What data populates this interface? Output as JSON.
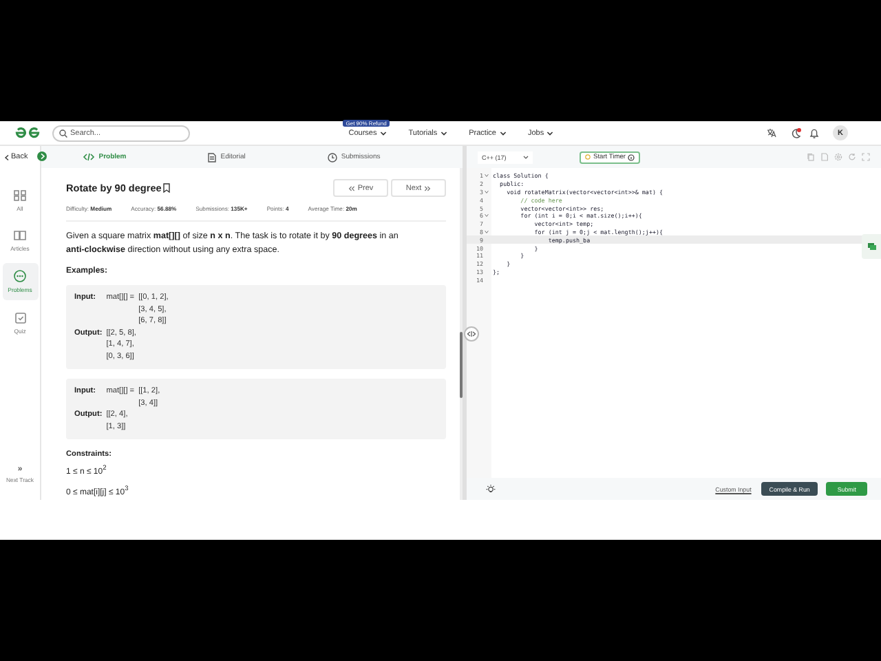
{
  "header": {
    "search": {
      "placeholder": "Search..."
    },
    "nav": [
      {
        "label": "Courses",
        "badge": "Get 90% Refund"
      },
      {
        "label": "Tutorials"
      },
      {
        "label": "Practice"
      },
      {
        "label": "Jobs"
      }
    ],
    "notification_dot": true,
    "avatar": "K"
  },
  "sidebar": {
    "back": "Back",
    "items": [
      {
        "label": "All",
        "selected": false
      },
      {
        "label": "Articles",
        "selected": false
      },
      {
        "label": "Problems",
        "selected": true
      },
      {
        "label": "Quiz",
        "selected": false
      }
    ],
    "next_track": {
      "icon": "»",
      "label": "Next Track"
    }
  },
  "tabs": [
    {
      "label": "Problem",
      "selected": true
    },
    {
      "label": "Editorial",
      "selected": false
    },
    {
      "label": "Submissions",
      "selected": false
    }
  ],
  "problem": {
    "title": "Rotate by 90 degree",
    "prev": "Prev",
    "next": "Next",
    "meta": [
      {
        "label": "Difficulty:",
        "value": "Medium"
      },
      {
        "label": "Accuracy:",
        "value": "56.88%"
      },
      {
        "label": "Submissions:",
        "value": "135K+"
      },
      {
        "label": "Points:",
        "value": "4"
      },
      {
        "label": "Average Time:",
        "value": "20m"
      }
    ],
    "description": "Given a square matrix **mat[][]** of size **n x n**. The task is to rotate it by **90 degrees** in an **anti-clockwise** direction without using any extra space.",
    "examples_heading": "Examples:",
    "examples": [
      {
        "input_label": "Input:",
        "input_prefix": "mat[][] =",
        "input_lines": [
          "[[0, 1, 2],",
          "[3, 4, 5],",
          "[6, 7, 8]]"
        ],
        "output_label": "Output:",
        "output_lines": [
          "[[2, 5, 8],",
          "[1, 4, 7],",
          "[0, 3, 6]]"
        ]
      },
      {
        "input_label": "Input:",
        "input_prefix": "mat[][] =",
        "input_lines": [
          "[[1, 2],",
          "[3, 4]]"
        ],
        "output_label": "Output:",
        "output_lines": [
          "[[2, 4],",
          "[1, 3]]"
        ]
      }
    ],
    "constraints_heading": "Constraints:",
    "constraints": [
      "1 ≤ n ≤ 10$^{2}$",
      "0 ≤ mat[i][j] ≤ 10$^{3}$"
    ]
  },
  "editor": {
    "language": "C++ (17)",
    "timer": "Start Timer",
    "lines": [
      {
        "number": "1",
        "code": "class Solution {",
        "fold": true,
        "current": false
      },
      {
        "number": "2",
        "code": "  public:",
        "fold": false,
        "current": false
      },
      {
        "number": "3",
        "code": "    void rotateMatrix(vector<vector<int>>& mat) {",
        "fold": true,
        "current": false
      },
      {
        "number": "4",
        "code": "        // code here",
        "fold": false,
        "current": false,
        "kind": "comment"
      },
      {
        "number": "5",
        "code": "        vector<vector<int>> res;",
        "fold": false,
        "current": false
      },
      {
        "number": "6",
        "code": "        for (int i = 0;i < mat.size();i++){",
        "fold": true,
        "current": false
      },
      {
        "number": "7",
        "code": "            vector<int> temp;",
        "fold": false,
        "current": false
      },
      {
        "number": "8",
        "code": "            for (int j = 0;j < mat.length();j++){",
        "fold": true,
        "current": false
      },
      {
        "number": "9",
        "code": "                temp.push_ba",
        "fold": false,
        "current": true
      },
      {
        "number": "10",
        "code": "            }",
        "fold": false,
        "current": false
      },
      {
        "number": "11",
        "code": "        }",
        "fold": false,
        "current": false
      },
      {
        "number": "12",
        "code": "    }",
        "fold": false,
        "current": false
      },
      {
        "number": "13",
        "code": "};",
        "fold": false,
        "current": false
      },
      {
        "number": "14",
        "fold": false,
        "current": false
      }
    ],
    "custom_input": "Custom Input",
    "compile": "Compile & Run",
    "submit": "Submit"
  }
}
